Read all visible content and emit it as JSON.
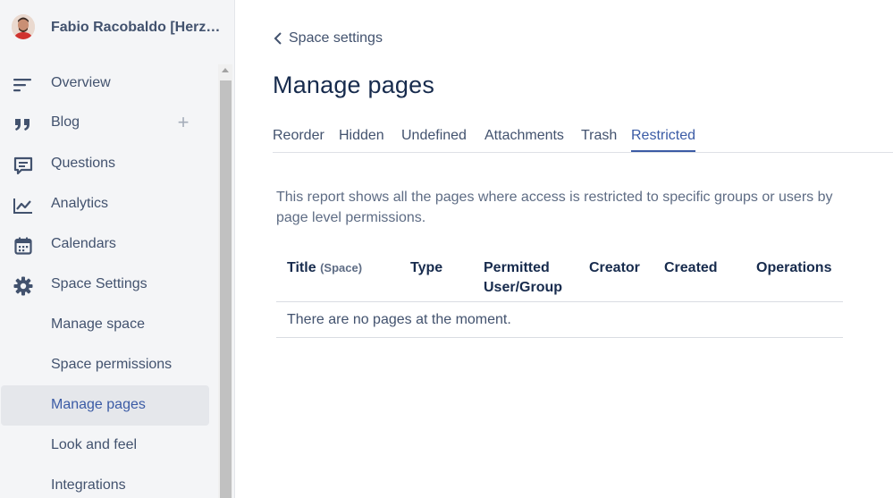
{
  "sidebar": {
    "space_name": "Fabio Racobaldo [Herzum]",
    "items": [
      {
        "label": "Overview",
        "icon": "overview-lines-icon"
      },
      {
        "label": "Blog",
        "icon": "quote-icon"
      },
      {
        "label": "Questions",
        "icon": "questions-icon"
      },
      {
        "label": "Analytics",
        "icon": "analytics-icon"
      },
      {
        "label": "Calendars",
        "icon": "calendar-icon"
      },
      {
        "label": "Space Settings",
        "icon": "gear-icon"
      }
    ],
    "sub_items": [
      {
        "label": "Manage space"
      },
      {
        "label": "Space permissions"
      },
      {
        "label": "Manage pages"
      },
      {
        "label": "Look and feel"
      },
      {
        "label": "Integrations"
      }
    ],
    "add_blog_label": "+"
  },
  "main": {
    "back_label": "Space settings",
    "title": "Manage pages",
    "tabs": [
      {
        "label": "Reorder"
      },
      {
        "label": "Hidden"
      },
      {
        "label": "Undefined"
      },
      {
        "label": "Attachments"
      },
      {
        "label": "Trash"
      },
      {
        "label": "Restricted"
      }
    ],
    "active_tab": "Restricted",
    "description": "This report shows all the pages where access is restricted to specific groups or users by page level permissions.",
    "table": {
      "columns": {
        "title": "Title",
        "title_suffix": "(Space)",
        "type": "Type",
        "permitted_line1": "Permitted",
        "permitted_line2": "User/Group",
        "creator": "Creator",
        "created": "Created",
        "operations": "Operations"
      },
      "empty_message": "There are no pages at the moment."
    }
  },
  "colors": {
    "accent": "#3b5ba5",
    "sidebar_bg": "#f4f5f7",
    "text": "#172b4d",
    "muted": "#42526e"
  }
}
